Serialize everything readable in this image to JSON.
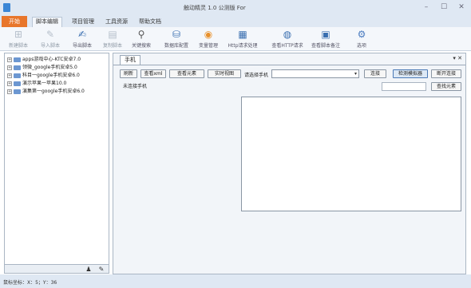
{
  "window": {
    "title": "触动精灵 1.0 公测版 For",
    "minimize": "–",
    "maximize": "☐",
    "close": "✕"
  },
  "menu": {
    "start": "开始",
    "items": [
      "脚本编辑",
      "项目管理",
      "工具资源",
      "帮助文档"
    ]
  },
  "ribbon": [
    {
      "label": "新建脚本",
      "icon": "new-script-icon",
      "glyph": "⊞"
    },
    {
      "label": "导入脚本",
      "icon": "import-script-icon",
      "glyph": "✎"
    },
    {
      "label": "导出脚本",
      "icon": "export-script-icon",
      "glyph": "✍"
    },
    {
      "label": "复制脚本",
      "icon": "copy-script-icon",
      "glyph": "▤"
    },
    {
      "label": "关键搜索",
      "icon": "search-icon",
      "glyph": "⚲"
    },
    {
      "label": "数据库配置",
      "icon": "database-icon",
      "glyph": "⛁"
    },
    {
      "label": "变量管理",
      "icon": "variable-icon",
      "glyph": "◉"
    },
    {
      "label": "Http请求处理",
      "icon": "http-icon",
      "glyph": "▦"
    },
    {
      "label": "查看HTTP请求",
      "icon": "view-http-icon",
      "glyph": "◍"
    },
    {
      "label": "查看脚本备注",
      "icon": "view-note-icon",
      "glyph": "▣"
    },
    {
      "label": "选项",
      "icon": "gear-icon",
      "glyph": "⚙"
    }
  ],
  "tree": [
    "apps游戏中心-KTC安卓7.0",
    "领微_google手机安卓5.0",
    "科目一google手机安卓6.0",
    "演示苹果一苹果10.0",
    "演集第一google手机安卓6.0"
  ],
  "tab": {
    "label": "手机",
    "controls": "▾ ✕"
  },
  "phone": {
    "buttons": [
      "刷新",
      "查看xml",
      "查看元素",
      "实时视图"
    ],
    "select_label": "请选择手机",
    "select_value": "",
    "connect": "连接",
    "view_screen": "检测模拟器",
    "disconnect": "断开连接",
    "status": "未连接手机",
    "find_input": "",
    "find_button": "查找元素"
  },
  "statusbar": {
    "text": "鼠标坐标：X：5；Y：36"
  }
}
